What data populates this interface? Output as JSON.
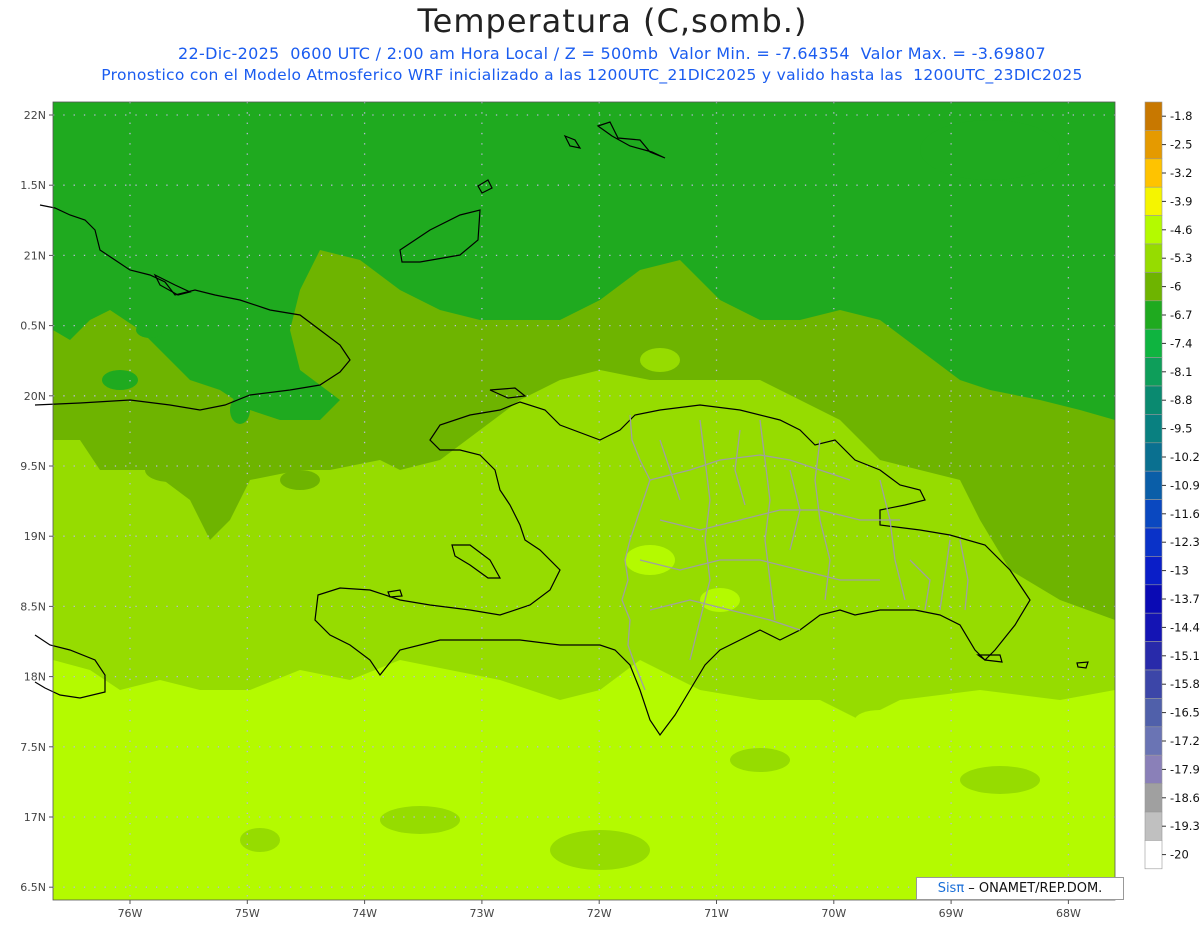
{
  "header": {
    "title": "Temperatura (C,somb.)",
    "line1": "22-Dic-2025  0600 UTC / 2:00 am Hora Local / Z = 500mb  Valor Min. = -7.64354  Valor Max. = -3.69807",
    "line2": "Pronostico con el Modelo Atmosferico WRF inicializado a las 1200UTC_21DIC2025 y valido hasta las  1200UTC_23DIC2025"
  },
  "map": {
    "lat_labels": [
      "22N",
      "1.5N",
      "21N",
      "0.5N",
      "20N",
      "9.5N",
      "19N",
      "8.5N",
      "18N",
      "7.5N",
      "17N",
      "6.5N"
    ],
    "lon_labels": [
      "76W",
      "75W",
      "74W",
      "73W",
      "72W",
      "71W",
      "70W",
      "69W",
      "68W"
    ],
    "colorbar_labels": [
      "-1.8",
      "-2.5",
      "-3.2",
      "-3.9",
      "-4.6",
      "-5.3",
      "-6",
      "-6.7",
      "-7.4",
      "-8.1",
      "-8.8",
      "-9.5",
      "-10.2",
      "-10.9",
      "-11.6",
      "-12.3",
      "-13",
      "-13.7",
      "-14.4",
      "-15.1",
      "-15.8",
      "-16.5",
      "-17.2",
      "-17.9",
      "-18.6",
      "-19.3",
      "-20"
    ],
    "colorbar_colors": [
      "#c87800",
      "#e59a00",
      "#ffc300",
      "#f5f500",
      "#b4fa00",
      "#96dc00",
      "#6eb400",
      "#1faa1f",
      "#0fb440",
      "#0e9e5a",
      "#0a8a70",
      "#098080",
      "#0a7090",
      "#0a5ea8",
      "#0a48c0",
      "#0a32c8",
      "#0a1ec8",
      "#0a0ab4",
      "#1414b4",
      "#282aaa",
      "#3c46a8",
      "#5060aa",
      "#6a74b4",
      "#8a80b8",
      "#a0a0a0",
      "#c0c0c0",
      "#ffffff"
    ],
    "temperature_zones": {
      "north": "#1faa1f",
      "mid": "#6eb400",
      "center": "#96dc00",
      "south": "#b4fa00"
    }
  },
  "watermark": {
    "brand": "Sisπ",
    "text": " – ONAMET/REP.DOM."
  }
}
